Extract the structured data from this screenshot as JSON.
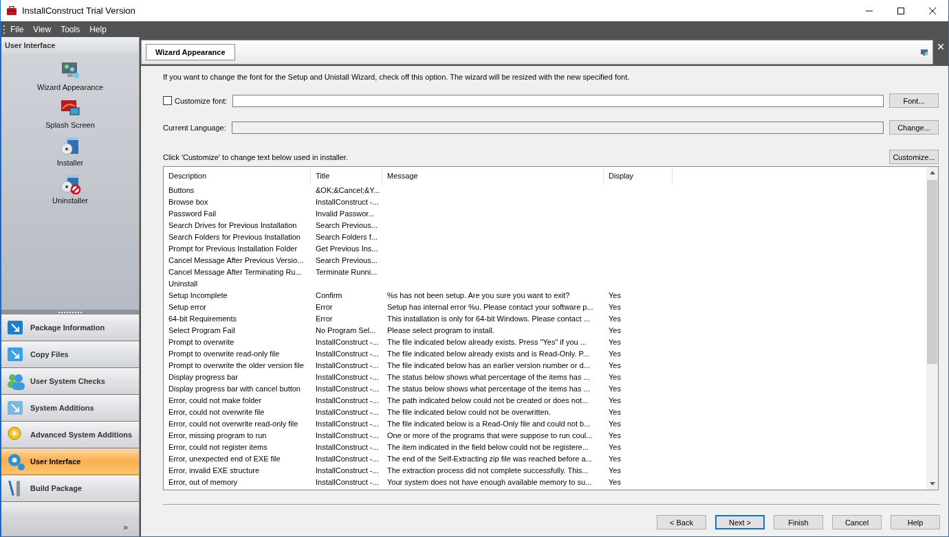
{
  "window": {
    "title": "InstallConstruct Trial Version"
  },
  "menu": [
    "File",
    "View",
    "Tools",
    "Help"
  ],
  "sidebar": {
    "header": "User Interface",
    "items": [
      {
        "label": "Wizard Appearance",
        "selected": false
      },
      {
        "label": "Splash Screen",
        "selected": false
      },
      {
        "label": "Installer",
        "selected": false
      },
      {
        "label": "Uninstaller",
        "selected": false
      }
    ],
    "nav": [
      {
        "label": "Package Information",
        "selected": false
      },
      {
        "label": "Copy Files",
        "selected": false
      },
      {
        "label": "User System Checks",
        "selected": false
      },
      {
        "label": "System Additions",
        "selected": false
      },
      {
        "label": "Advanced System Additions",
        "selected": false
      },
      {
        "label": "User Interface",
        "selected": true
      },
      {
        "label": "Build Package",
        "selected": false
      }
    ],
    "more": "»"
  },
  "panel": {
    "tab": "Wizard Appearance",
    "intro": "If you want to change the font for the Setup and Unistall Wizard, check off this option.  The wizard will be resized with the new specified font.",
    "customize_font": {
      "label": "Customize font:",
      "checked": false
    },
    "font_button": "Font...",
    "language_label": "Current Language:",
    "change_button": "Change...",
    "table_hint": "Click 'Customize' to change text below used in installer.",
    "customize_button": "Customize...",
    "table": {
      "columns": [
        "Description",
        "Title",
        "Message",
        "Display"
      ],
      "rows": [
        {
          "description": "Buttons",
          "title": "&OK;&Cancel;&Y..."
        },
        {
          "description": "Browse box",
          "title": "InstallConstruct -..."
        },
        {
          "description": "Password Fail",
          "title": "Invalid Passwor..."
        },
        {
          "description": "Search Drives for Previous Installation",
          "title": "Search Previous..."
        },
        {
          "description": "Search Folders for Previous Installation",
          "title": "Search Folders f..."
        },
        {
          "description": "Prompt for Previous Installation Folder",
          "title": "Get Previous Ins..."
        },
        {
          "description": "Cancel Message After Previous Versio...",
          "title": "Search Previous..."
        },
        {
          "description": "Cancel Message After Terminating Ru...",
          "title": "Terminate Runni..."
        },
        {
          "description": "Uninstall"
        },
        {
          "description": "Setup Incomplete",
          "title": "Confirm",
          "message": "%s has not been setup. Are you sure you want to exit?",
          "display": "Yes"
        },
        {
          "description": "Setup error",
          "title": "Error",
          "message": "Setup has internal error %u. Please contact your software p...",
          "display": "Yes"
        },
        {
          "description": "64-bit Requirements",
          "title": "Error",
          "message": "This installation is only for 64-bit Windows. Please contact ...",
          "display": "Yes"
        },
        {
          "description": "Select Program Fail",
          "title": "No Program Sel...",
          "message": "Please select program to install.",
          "display": "Yes"
        },
        {
          "description": "Prompt to overwrite",
          "title": "InstallConstruct -...",
          "message": "The file indicated below already exists.  Press \"Yes\" if you ...",
          "display": "Yes"
        },
        {
          "description": "Prompt to overwrite read-only file",
          "title": "InstallConstruct -...",
          "message": "The file indicated below already exists and is Read-Only.  P...",
          "display": "Yes"
        },
        {
          "description": "Prompt to overwrite the older version file",
          "title": "InstallConstruct -...",
          "message": "The file indicated below has an earlier version number or d...",
          "display": "Yes"
        },
        {
          "description": "Display progress bar",
          "title": "InstallConstruct -...",
          "message": "The status below shows what percentage of the items has ...",
          "display": "Yes"
        },
        {
          "description": "Display progress bar with cancel button",
          "title": "InstallConstruct -...",
          "message": "The status below shows what percentage of the items has ...",
          "display": "Yes"
        },
        {
          "description": "Error, could not make folder",
          "title": "InstallConstruct -...",
          "message": "The path indicated below could not be created or does not...",
          "display": "Yes"
        },
        {
          "description": "Error, could not overwrite file",
          "title": "InstallConstruct -...",
          "message": "The file indicated below could not be overwritten.",
          "display": "Yes"
        },
        {
          "description": "Error, could not overwrite read-only file",
          "title": "InstallConstruct -...",
          "message": "The file indicated below is a Read-Only file and could not b...",
          "display": "Yes"
        },
        {
          "description": "Error, missing program to run",
          "title": "InstallConstruct -...",
          "message": "One or more of the programs that were suppose to run coul...",
          "display": "Yes"
        },
        {
          "description": "Error, could not register items",
          "title": "InstallConstruct -...",
          "message": "The item indicated in the field below could not be registere...",
          "display": "Yes"
        },
        {
          "description": "Error, unexpected end of EXE file",
          "title": "InstallConstruct -...",
          "message": "The end of the Self-Extracting zip file was reached before a...",
          "display": "Yes"
        },
        {
          "description": "Error, invalid EXE structure",
          "title": "InstallConstruct -...",
          "message": "The extraction process did not complete successfully.  This...",
          "display": "Yes"
        },
        {
          "description": "Error, out of memory",
          "title": "InstallConstruct -...",
          "message": "Your system does not have enough available memory to su...",
          "display": "Yes"
        }
      ]
    }
  },
  "footer": {
    "buttons": [
      {
        "label": "< Back",
        "default": false
      },
      {
        "label": "Next >",
        "default": true
      },
      {
        "label": "Finish",
        "default": false
      },
      {
        "label": "Cancel",
        "default": false
      },
      {
        "label": "Help",
        "default": false
      }
    ]
  }
}
